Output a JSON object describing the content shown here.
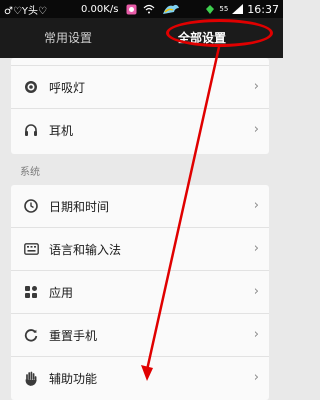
{
  "status_bar": {
    "left_symbols": "♂♡Y头♡",
    "net_speed": "0.00K/s",
    "battery_level": "55",
    "time": "16:37"
  },
  "tabs": {
    "common": "常用设置",
    "all": "全部设置",
    "selected": "全部设置"
  },
  "top_items": [
    {
      "label": "呼吸灯",
      "icon": "breathing-light-icon"
    },
    {
      "label": "耳机",
      "icon": "headphones-icon"
    }
  ],
  "system_section": {
    "title": "系统",
    "items": [
      {
        "label": "日期和时间",
        "icon": "clock-icon"
      },
      {
        "label": "语言和输入法",
        "icon": "keyboard-icon"
      },
      {
        "label": "应用",
        "icon": "apps-icon"
      },
      {
        "label": "重置手机",
        "icon": "reset-icon"
      },
      {
        "label": "辅助功能",
        "icon": "hand-icon"
      }
    ]
  },
  "annotation": {
    "color": "#e00000"
  }
}
